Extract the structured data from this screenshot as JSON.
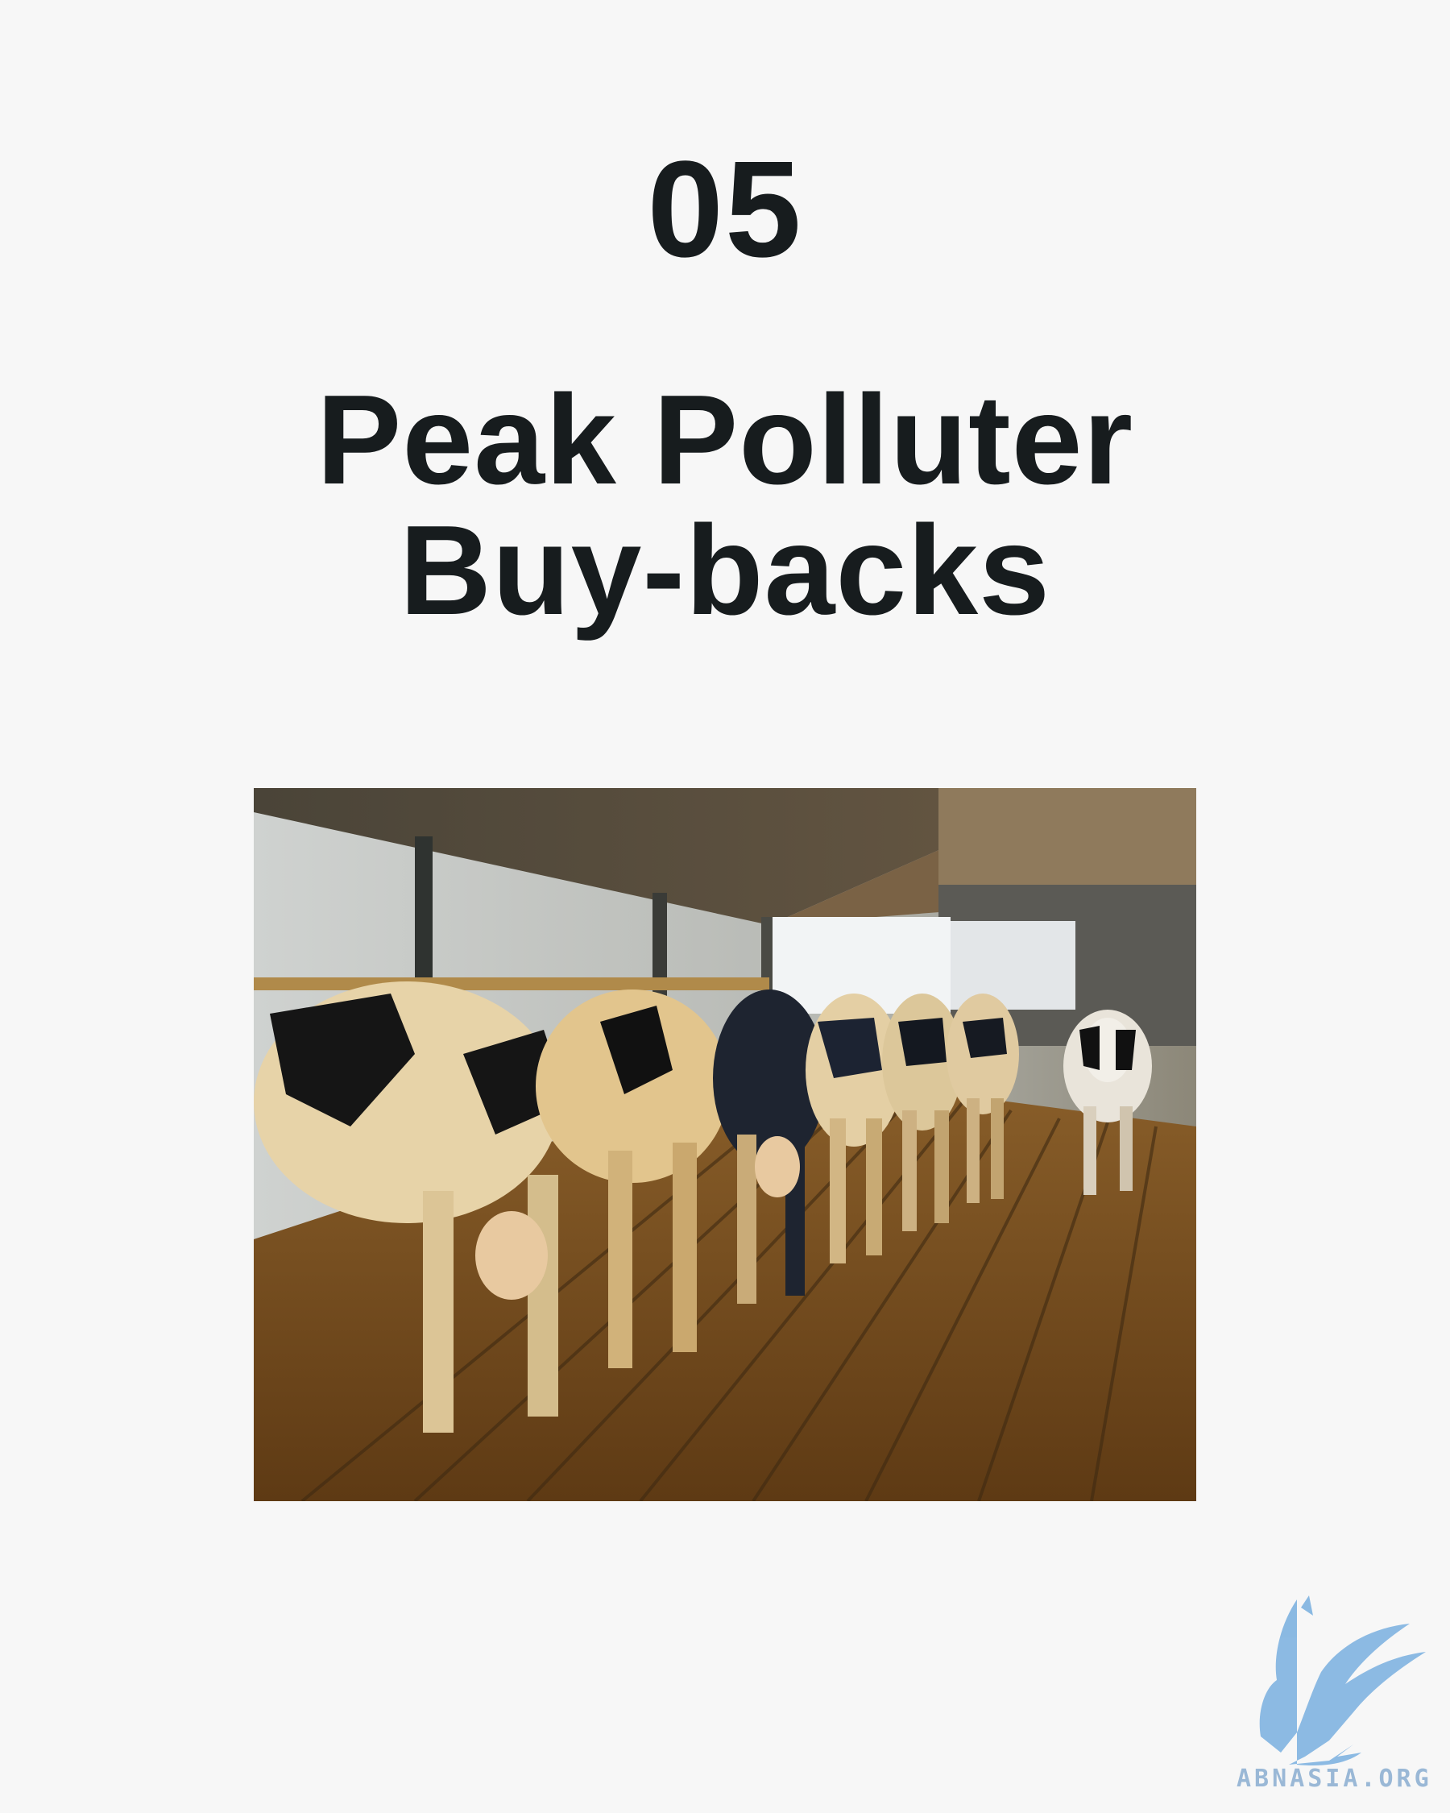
{
  "slide": {
    "number": "05",
    "title_line1": "Peak Polluter",
    "title_line2": "Buy-backs"
  },
  "photo": {
    "subject": "cows-in-barn"
  },
  "logo": {
    "text": "ABNASIA.ORG",
    "color": "#7fb3e0"
  }
}
